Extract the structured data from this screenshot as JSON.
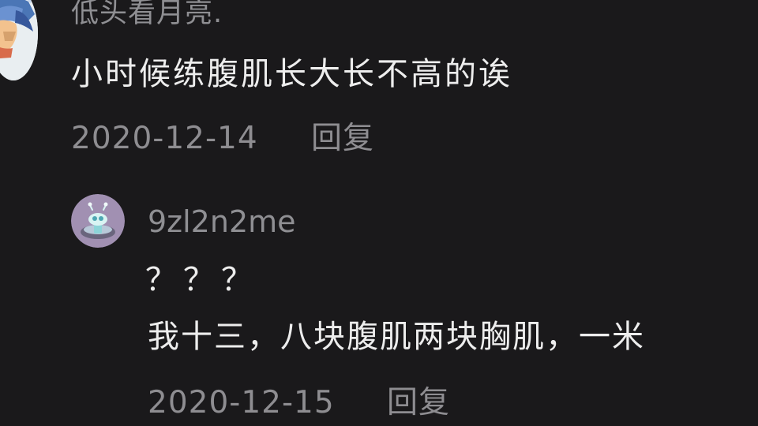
{
  "comment": {
    "username": "低头看月亮.",
    "text": "小时候练腹肌长大长不高的诶",
    "date": "2020-12-14",
    "reply_label": "回复"
  },
  "reply": {
    "username": "9zl2n2me",
    "line1": "？？？",
    "line2": "我十三，八块腹肌两块胸肌，一米",
    "date": "2020-12-15",
    "reply_label": "回复"
  },
  "colors": {
    "background": "#1a191b",
    "primary_text": "#ededed",
    "secondary_text": "#8e8d91"
  },
  "icons": {
    "main_avatar": "avatar",
    "reply_avatar": "alien-avatar"
  }
}
